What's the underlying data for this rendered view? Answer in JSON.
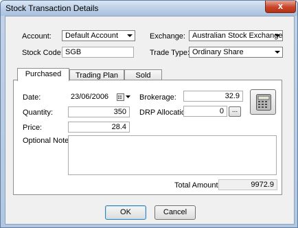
{
  "window": {
    "title": "Stock Transaction Details",
    "close_glyph": "x"
  },
  "form": {
    "account_label": "Account:",
    "account_value": "Default Account",
    "exchange_label": "Exchange:",
    "exchange_value": "Australian Stock Exchange",
    "stock_code_label": "Stock Code:",
    "stock_code_value": "SGB",
    "trade_type_label": "Trade Type:",
    "trade_type_value": "Ordinary Share"
  },
  "tabs": [
    {
      "label": "Purchased",
      "active": true
    },
    {
      "label": "Trading Plan",
      "active": false
    },
    {
      "label": "Sold",
      "active": false
    }
  ],
  "purchased": {
    "date_label": "Date:",
    "date_value": "23/06/2006",
    "quantity_label": "Quantity:",
    "quantity_value": "350",
    "price_label": "Price:",
    "price_value": "28.4",
    "brokerage_label": "Brokerage:",
    "brokerage_value": "32.9",
    "drp_label": "DRP Allocation:",
    "drp_value": "0",
    "drp_button": "...",
    "note_label": "Optional Note:",
    "note_value": "",
    "total_label": "Total Amount:",
    "total_value": "9972.9"
  },
  "buttons": {
    "ok": "OK",
    "cancel": "Cancel"
  },
  "icons": {
    "calendar": "calendar-icon",
    "calculator": "calculator-icon",
    "close": "close-icon"
  }
}
